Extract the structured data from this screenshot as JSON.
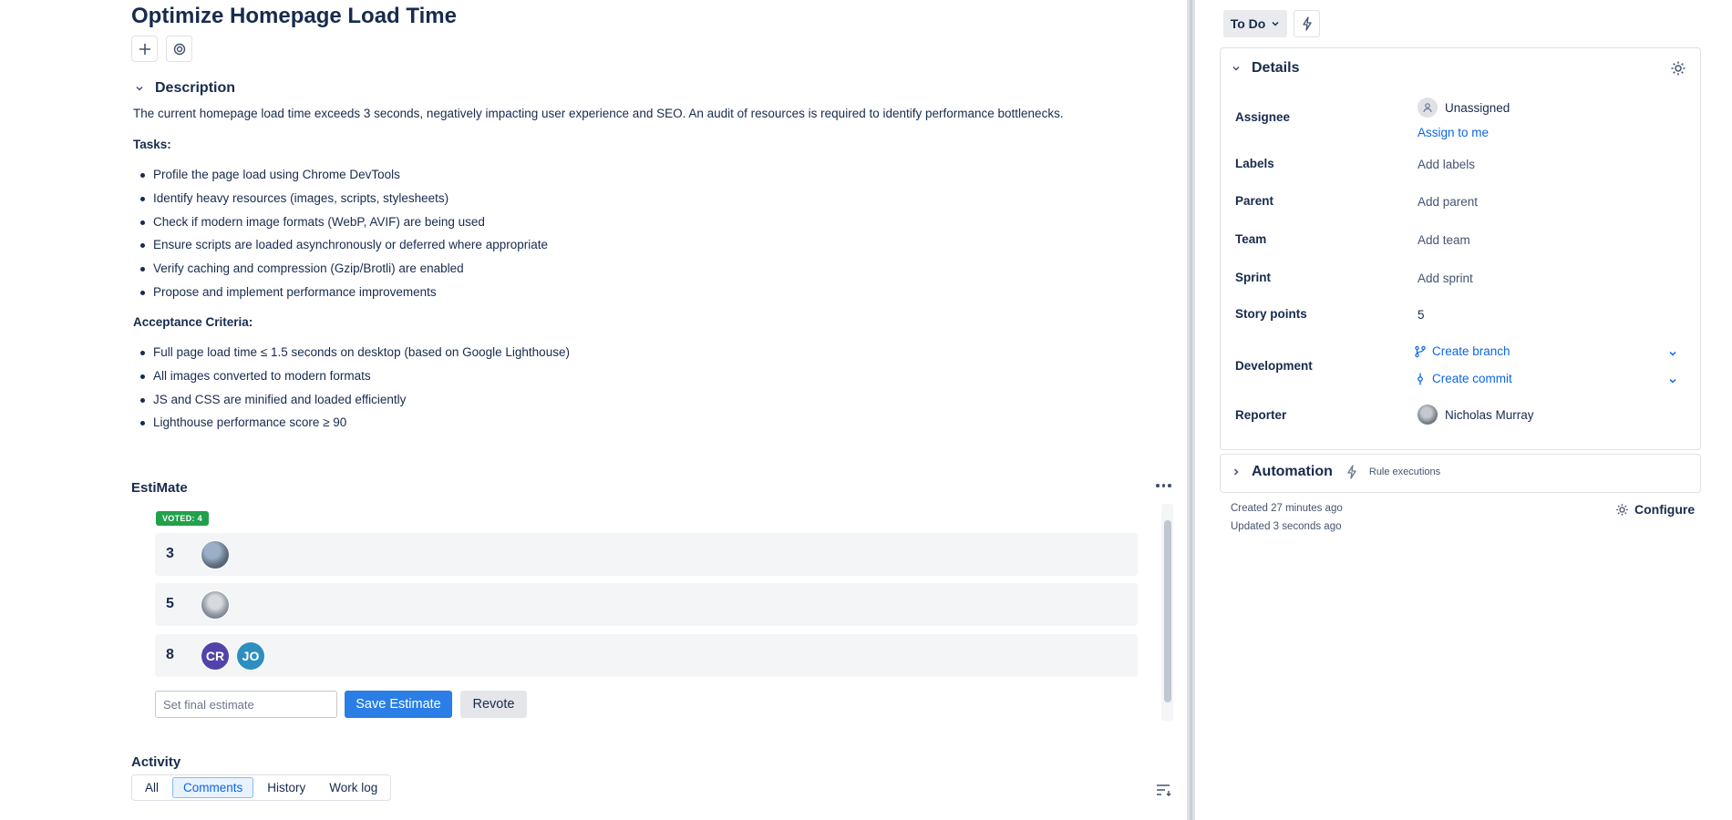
{
  "issue": {
    "title": "Optimize Homepage Load Time"
  },
  "description": {
    "heading": "Description",
    "text": "The current homepage load time exceeds 3 seconds, negatively impacting user experience and SEO. An audit of resources is required to identify performance bottlenecks.",
    "tasks_label": "Tasks:",
    "tasks": [
      "Profile the page load using Chrome DevTools",
      "Identify heavy resources (images, scripts, stylesheets)",
      "Check if modern image formats (WebP, AVIF) are being used",
      "Ensure scripts are loaded asynchronously or deferred where appropriate",
      "Verify caching and compression (Gzip/Brotli) are enabled",
      "Propose and implement performance improvements"
    ],
    "criteria_label": "Acceptance Criteria:",
    "criteria": [
      "Full page load time ≤ 1.5 seconds on desktop (based on Google Lighthouse)",
      "All images converted to modern formats",
      "JS and CSS are minified and loaded efficiently",
      "Lighthouse performance score ≥ 90"
    ]
  },
  "estimate": {
    "title": "EstiMate",
    "voted_badge": "VOTED: 4",
    "rows": [
      {
        "value": "3",
        "avatars": [
          "photo1"
        ]
      },
      {
        "value": "5",
        "avatars": [
          "photo2"
        ]
      },
      {
        "value": "8",
        "avatars": [
          "CR",
          "JO"
        ]
      }
    ],
    "final_placeholder": "Set final estimate",
    "save_label": "Save Estimate",
    "revote_label": "Revote"
  },
  "activity": {
    "title": "Activity",
    "tabs": [
      "All",
      "Comments",
      "History",
      "Work log"
    ],
    "active_tab": "Comments"
  },
  "sidebar": {
    "status": "To Do",
    "details": {
      "heading": "Details",
      "assignee_label": "Assignee",
      "assignee_value": "Unassigned",
      "assign_to_me": "Assign to me",
      "labels_label": "Labels",
      "labels_value": "Add labels",
      "parent_label": "Parent",
      "parent_value": "Add parent",
      "team_label": "Team",
      "team_value": "Add team",
      "sprint_label": "Sprint",
      "sprint_value": "Add sprint",
      "story_points_label": "Story points",
      "story_points_value": "5",
      "development_label": "Development",
      "create_branch": "Create branch",
      "create_commit": "Create commit",
      "reporter_label": "Reporter",
      "reporter_value": "Nicholas Murray"
    },
    "automation": {
      "heading": "Automation",
      "rule_executions": "Rule executions"
    },
    "created": "Created 27 minutes ago",
    "updated": "Updated 3 seconds ago",
    "configure": "Configure"
  },
  "colors": {
    "primary_button": "#2a7ee6",
    "voted_badge": "#22a04b",
    "link": "#0c66e4",
    "avatar_cr": "#5243aa",
    "avatar_jo": "#2d8fbf"
  }
}
